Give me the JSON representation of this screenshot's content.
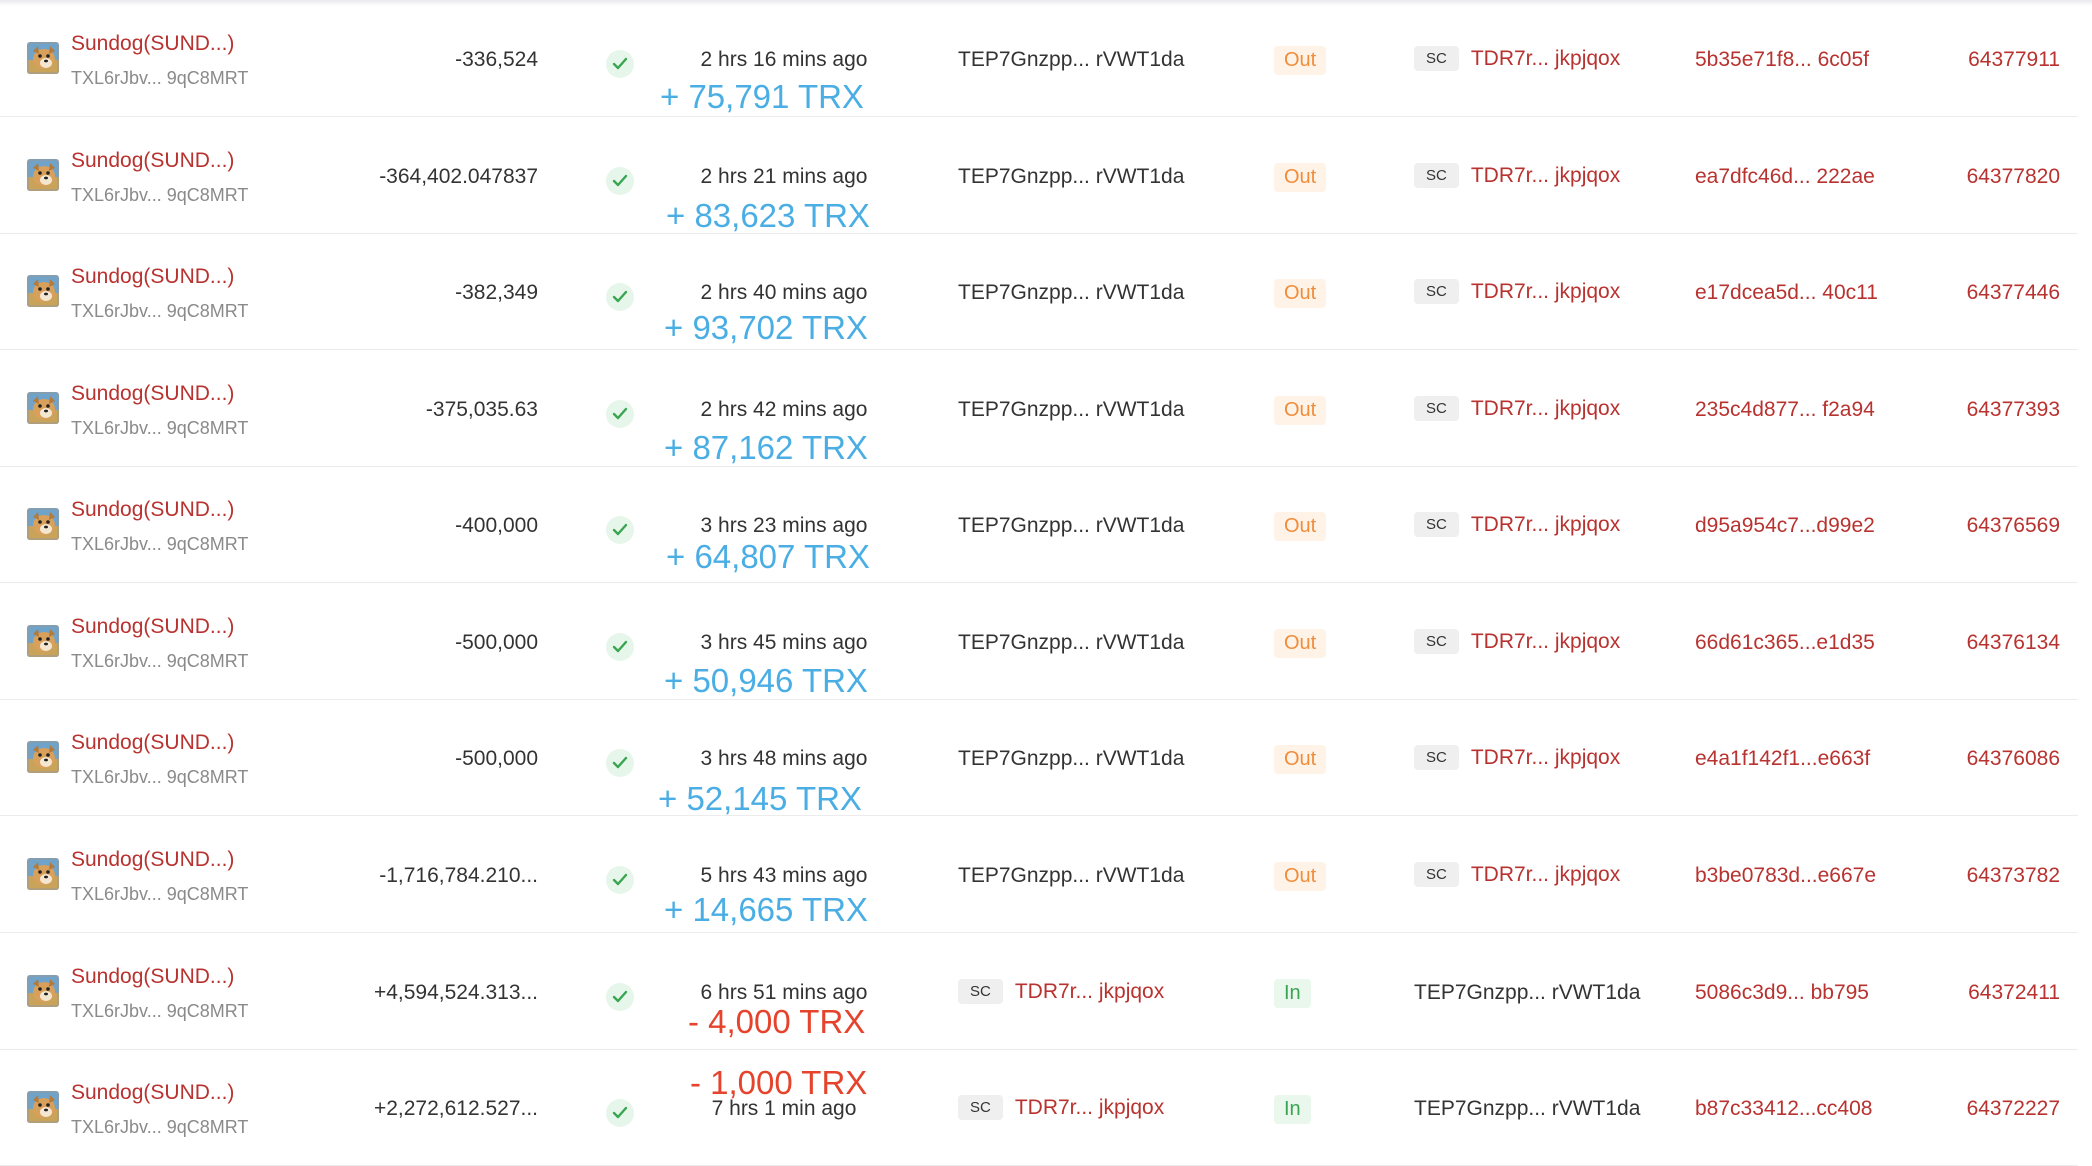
{
  "rows": [
    {
      "token_name": "Sundog(SUND...)",
      "token_addr": "TXL6rJbv...  9qC8MRT",
      "amount": "-336,524",
      "age": "2 hrs 16 mins ago",
      "trx_change": "+ 75,791 TRX",
      "trx_sign": "pos",
      "from": "TEP7Gnzpp... rVWT1da",
      "direction": "Out",
      "to": "TDR7r...  jkpjqox",
      "hash": "5b35e71f8...  6c05f",
      "block": "64377911"
    },
    {
      "token_name": "Sundog(SUND...)",
      "token_addr": "TXL6rJbv...  9qC8MRT",
      "amount": "-364,402.047837",
      "age": "2 hrs 21 mins ago",
      "trx_change": "+ 83,623 TRX",
      "trx_sign": "pos",
      "from": "TEP7Gnzpp... rVWT1da",
      "direction": "Out",
      "to": "TDR7r...  jkpjqox",
      "hash": "ea7dfc46d...  222ae",
      "block": "64377820"
    },
    {
      "token_name": "Sundog(SUND...)",
      "token_addr": "TXL6rJbv...  9qC8MRT",
      "amount": "-382,349",
      "age": "2 hrs 40 mins ago",
      "trx_change": "+ 93,702 TRX",
      "trx_sign": "pos",
      "from": "TEP7Gnzpp... rVWT1da",
      "direction": "Out",
      "to": "TDR7r...  jkpjqox",
      "hash": "e17dcea5d... 40c11",
      "block": "64377446"
    },
    {
      "token_name": "Sundog(SUND...)",
      "token_addr": "TXL6rJbv...  9qC8MRT",
      "amount": "-375,035.63",
      "age": "2 hrs 42 mins ago",
      "trx_change": "+ 87,162 TRX",
      "trx_sign": "pos",
      "from": "TEP7Gnzpp... rVWT1da",
      "direction": "Out",
      "to": "TDR7r...  jkpjqox",
      "hash": "235c4d877... f2a94",
      "block": "64377393"
    },
    {
      "token_name": "Sundog(SUND...)",
      "token_addr": "TXL6rJbv...  9qC8MRT",
      "amount": "-400,000",
      "age": "3 hrs 23 mins ago",
      "trx_change": "+ 64,807 TRX",
      "trx_sign": "pos",
      "from": "TEP7Gnzpp... rVWT1da",
      "direction": "Out",
      "to": "TDR7r...  jkpjqox",
      "hash": "d95a954c7...d99e2",
      "block": "64376569"
    },
    {
      "token_name": "Sundog(SUND...)",
      "token_addr": "TXL6rJbv...  9qC8MRT",
      "amount": "-500,000",
      "age": "3 hrs 45 mins ago",
      "trx_change": "+ 50,946 TRX",
      "trx_sign": "pos",
      "from": "TEP7Gnzpp... rVWT1da",
      "direction": "Out",
      "to": "TDR7r...  jkpjqox",
      "hash": "66d61c365...e1d35",
      "block": "64376134"
    },
    {
      "token_name": "Sundog(SUND...)",
      "token_addr": "TXL6rJbv...  9qC8MRT",
      "amount": "-500,000",
      "age": "3 hrs 48 mins ago",
      "trx_change": "+ 52,145 TRX",
      "trx_sign": "pos",
      "from": "TEP7Gnzpp... rVWT1da",
      "direction": "Out",
      "to": "TDR7r...  jkpjqox",
      "hash": "e4a1f142f1...e663f",
      "block": "64376086"
    },
    {
      "token_name": "Sundog(SUND...)",
      "token_addr": "TXL6rJbv...  9qC8MRT",
      "amount": "-1,716,784.210...",
      "age": "5 hrs 43 mins ago",
      "trx_change": "+ 14,665 TRX",
      "trx_sign": "pos",
      "from": "TEP7Gnzpp... rVWT1da",
      "direction": "Out",
      "to": "TDR7r...  jkpjqox",
      "hash": "b3be0783d...e667e",
      "block": "64373782"
    },
    {
      "token_name": "Sundog(SUND...)",
      "token_addr": "TXL6rJbv...  9qC8MRT",
      "amount": "+4,594,524.313...",
      "age": "6 hrs 51 mins ago",
      "trx_change": "- 4,000 TRX",
      "trx_sign": "neg",
      "from": "TDR7r...  jkpjqox",
      "direction": "In",
      "to": "TEP7Gnzpp... rVWT1da",
      "hash": "5086c3d9...  bb795",
      "block": "64372411"
    },
    {
      "token_name": "Sundog(SUND...)",
      "token_addr": "TXL6rJbv...  9qC8MRT",
      "amount": "+2,272,612.527...",
      "age": "7 hrs 1 min ago",
      "trx_change": "- 1,000 TRX",
      "trx_sign": "neg",
      "from": "TDR7r...  jkpjqox",
      "direction": "In",
      "to": "TEP7Gnzpp... rVWT1da",
      "hash": "b87c33412...cc408",
      "block": "64372227"
    }
  ],
  "sc_label": "SC",
  "colors": {
    "link": "#b8322f",
    "out": "#f08c3a",
    "in": "#3aa551",
    "trx_positive": "#4aaee4",
    "trx_negative": "#e5432c",
    "status_ok": "#3aa551"
  },
  "icons": {
    "token": "sundog-dog-icon",
    "status": "check-circle-icon"
  }
}
